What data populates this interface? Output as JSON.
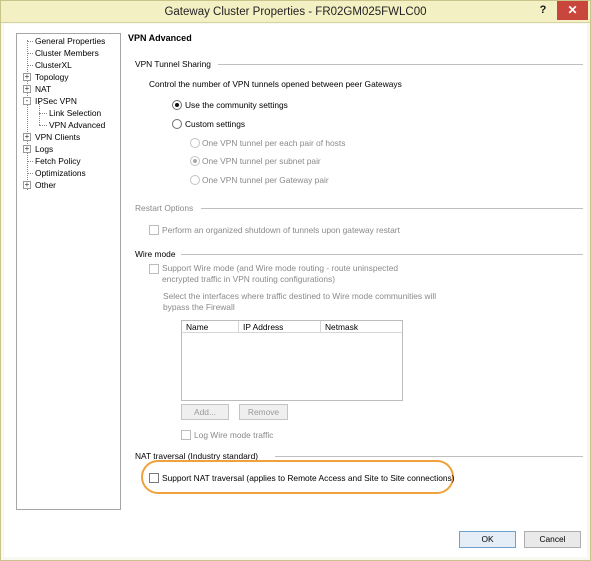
{
  "window": {
    "title": "Gateway Cluster Properties - FR02GM025FWLC00",
    "help_label": "?",
    "close_label": "✕"
  },
  "tree": {
    "items": [
      {
        "label": "General Properties"
      },
      {
        "label": "Cluster Members"
      },
      {
        "label": "ClusterXL"
      },
      {
        "label": "Topology",
        "expander": "+"
      },
      {
        "label": "NAT",
        "expander": "+"
      },
      {
        "label": "IPSec VPN",
        "expander": "-"
      },
      {
        "label": "Link Selection"
      },
      {
        "label": "VPN Advanced"
      },
      {
        "label": "VPN Clients",
        "expander": "+"
      },
      {
        "label": "Logs",
        "expander": "+"
      },
      {
        "label": "Fetch Policy"
      },
      {
        "label": "Optimizations"
      },
      {
        "label": "Other",
        "expander": "+"
      }
    ]
  },
  "page": {
    "heading": "VPN Advanced",
    "tunnel_sharing": {
      "title": "VPN Tunnel Sharing",
      "description": "Control the number of VPN tunnels opened between peer Gateways",
      "use_community": "Use the community settings",
      "custom": "Custom settings",
      "per_host": "One VPN tunnel per each pair of hosts",
      "per_subnet": "One VPN tunnel per subnet pair",
      "per_gateway": "One VPN tunnel per Gateway pair"
    },
    "restart": {
      "title": "Restart Options",
      "organized_shutdown": "Perform an organized shutdown of tunnels upon gateway restart"
    },
    "wire_mode": {
      "title": "Wire mode",
      "support_line1": "Support Wire mode (and Wire mode routing -  route uninspected",
      "support_line2": "encrypted traffic in VPN routing configurations)",
      "select_line1": "Select the interfaces where traffic destined to Wire mode communities will",
      "select_line2": "bypass the Firewall",
      "columns": [
        "Name",
        "IP Address",
        "Netmask"
      ],
      "add_label": "Add...",
      "remove_label": "Remove",
      "log_traffic": "Log Wire mode traffic"
    },
    "nat_traversal": {
      "title": "NAT traversal (Industry standard)",
      "support": "Support NAT traversal (applies to Remote Access and Site to Site connections)"
    }
  },
  "footer": {
    "ok_label": "OK",
    "cancel_label": "Cancel"
  },
  "colors": {
    "highlight": "#f0a13c",
    "titlebar": "#f3f0c4",
    "close": "#c9463d"
  }
}
